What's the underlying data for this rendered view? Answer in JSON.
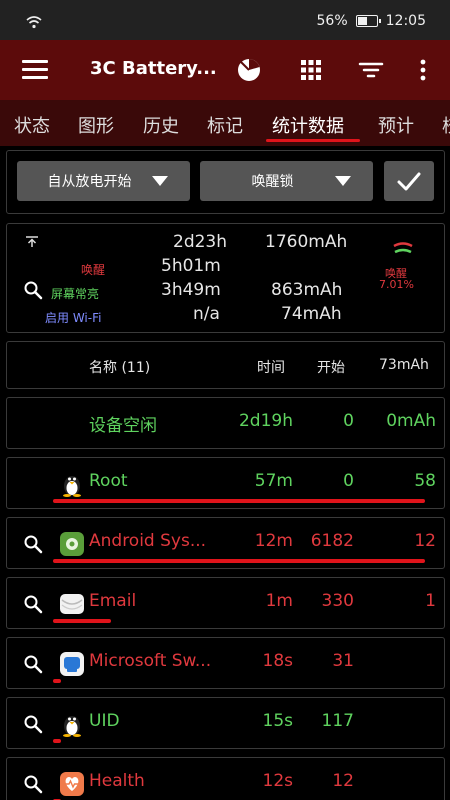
{
  "status": {
    "battery_pct": "56%",
    "time": "12:05",
    "battery_level": 0.56
  },
  "app": {
    "title": "3C Battery..."
  },
  "tabs": [
    "状态",
    "图形",
    "历史",
    "标记",
    "统计数据",
    "预计",
    "校"
  ],
  "active_tab": 4,
  "filters": {
    "period": "自从放电开始",
    "category": "唤醒锁"
  },
  "summary": {
    "total_time": "2d23h",
    "total_mah": "1760mAh",
    "awake_label": "唤醒",
    "awake_time": "5h01m",
    "screen_on_label": "屏幕常亮",
    "screen_on_time": "3h49m",
    "screen_on_mah": "863mAh",
    "wifi_label": "启用 Wi-Fi",
    "wifi_time": "n/a",
    "wifi_mah": "74mAh",
    "gauge_label": "唤醒",
    "gauge_pct": "7.01%"
  },
  "table": {
    "headers": {
      "name": "名称 (11)",
      "time": "时间",
      "start": "开始",
      "mah": "73mAh"
    },
    "rows": [
      {
        "name": "设备空闲",
        "time": "2d19h",
        "start": "0",
        "mah": "0mAh",
        "color": "#5fd35f",
        "icon": "",
        "has_search": false,
        "usage": 0
      },
      {
        "name": "Root",
        "time": "57m",
        "start": "0",
        "mah": "58",
        "color": "#5fd35f",
        "icon": "penguin-icon",
        "has_search": false,
        "usage": 0.97
      },
      {
        "name": "Android Sys...",
        "time": "12m",
        "start": "6182",
        "mah": "12",
        "color": "#e0393e",
        "icon": "android-system-icon",
        "has_search": true,
        "usage": 0.97
      },
      {
        "name": "Email",
        "time": "1m",
        "start": "330",
        "mah": "1",
        "color": "#e0393e",
        "icon": "email-icon",
        "has_search": true,
        "usage": 0.15
      },
      {
        "name": "Microsoft Sw...",
        "time": "18s",
        "start": "31",
        "mah": "",
        "color": "#e0393e",
        "icon": "microsoft-swiftkey-icon",
        "has_search": true,
        "usage": 0.02
      },
      {
        "name": "UID",
        "time": "15s",
        "start": "117",
        "mah": "",
        "color": "#5fd35f",
        "icon": "penguin-icon",
        "has_search": true,
        "usage": 0.02
      },
      {
        "name": "Health",
        "time": "12s",
        "start": "12",
        "mah": "",
        "color": "#e0393e",
        "icon": "health-icon",
        "has_search": true,
        "usage": 0.02
      }
    ]
  }
}
